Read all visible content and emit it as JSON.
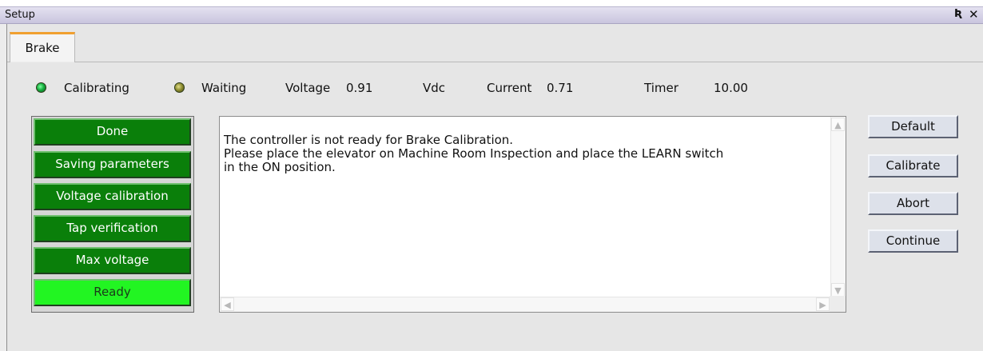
{
  "window": {
    "title": "Setup",
    "pin_icon": "pin-icon",
    "close_icon": "close-icon"
  },
  "tabs": [
    {
      "label": "Brake",
      "active": true
    }
  ],
  "indicators": [
    {
      "label": "Calibrating",
      "state": "on",
      "color": "#18b040"
    },
    {
      "label": "Waiting",
      "state": "off",
      "color": "#8a8a2e"
    }
  ],
  "readouts": {
    "voltage_label": "Voltage",
    "voltage_value": "0.91",
    "voltage_unit": "Vdc",
    "current_label": "Current",
    "current_value": "0.71",
    "timer_label": "Timer",
    "timer_value": "10.00"
  },
  "steps": [
    {
      "label": "Done",
      "active": false
    },
    {
      "label": "Saving parameters",
      "active": false
    },
    {
      "label": "Voltage calibration",
      "active": false
    },
    {
      "label": "Tap verification",
      "active": false
    },
    {
      "label": "Max voltage",
      "active": false
    },
    {
      "label": "Ready",
      "active": true
    }
  ],
  "step_colors": {
    "inactive": "#0a7f0a",
    "active": "#22f522"
  },
  "message": "The controller is not ready for Brake Calibration.\nPlease place the elevator on Machine Room Inspection and place the LEARN switch\nin the ON position.",
  "actions": {
    "default": "Default",
    "calibrate": "Calibrate",
    "abort": "Abort",
    "continue": "Continue"
  }
}
